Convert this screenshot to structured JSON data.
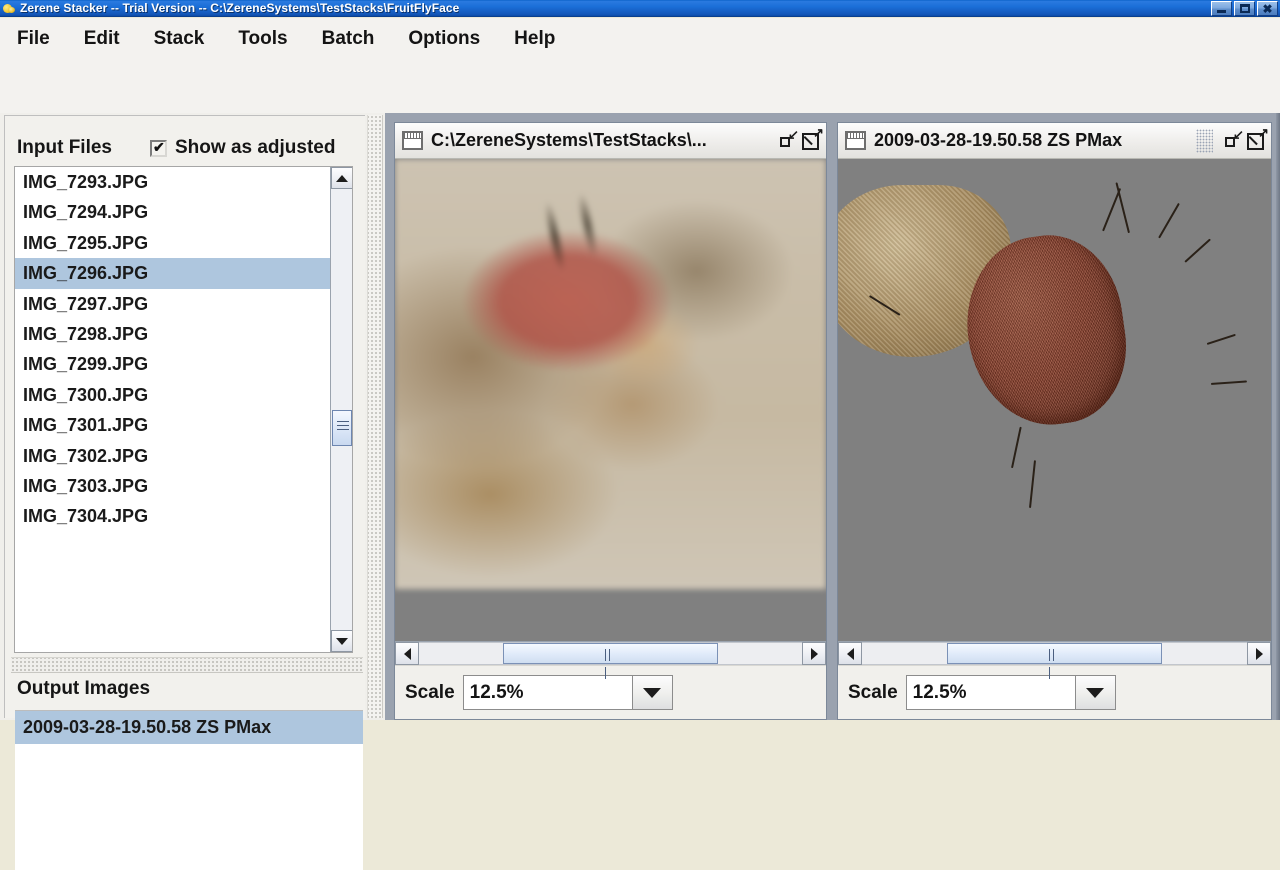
{
  "window": {
    "title": "Zerene Stacker -- Trial Version -- C:\\ZereneSystems\\TestStacks\\FruitFlyFace",
    "icon": "zerene-app-icon",
    "buttons": {
      "minimize": "minimize-icon",
      "maximize": "maximize-icon",
      "close": "close-icon"
    }
  },
  "menubar": {
    "items": [
      {
        "label": "File"
      },
      {
        "label": "Edit"
      },
      {
        "label": "Stack"
      },
      {
        "label": "Tools"
      },
      {
        "label": "Batch"
      },
      {
        "label": "Options"
      },
      {
        "label": "Help"
      }
    ]
  },
  "left_panel": {
    "input_files_label": "Input Files",
    "show_as_adjusted": {
      "label": "Show as adjusted",
      "checked": true
    },
    "files": [
      {
        "name": "IMG_7293.JPG",
        "selected": false
      },
      {
        "name": "IMG_7294.JPG",
        "selected": false
      },
      {
        "name": "IMG_7295.JPG",
        "selected": false
      },
      {
        "name": "IMG_7296.JPG",
        "selected": true
      },
      {
        "name": "IMG_7297.JPG",
        "selected": false
      },
      {
        "name": "IMG_7298.JPG",
        "selected": false
      },
      {
        "name": "IMG_7299.JPG",
        "selected": false
      },
      {
        "name": "IMG_7300.JPG",
        "selected": false
      },
      {
        "name": "IMG_7301.JPG",
        "selected": false
      },
      {
        "name": "IMG_7302.JPG",
        "selected": false
      },
      {
        "name": "IMG_7303.JPG",
        "selected": false
      },
      {
        "name": "IMG_7304.JPG",
        "selected": false
      }
    ],
    "output_images_label": "Output Images",
    "output_images": [
      {
        "name": "2009-03-28-19.50.58 ZS PMax",
        "selected": true
      }
    ]
  },
  "frames": [
    {
      "id": "input-preview",
      "caption": "C:\\ZereneSystems\\TestStacks\\...",
      "icon": "window-frame-icon",
      "restore_icon": "restore-down-icon",
      "maximize_icon": "maximize-window-icon",
      "scale_label": "Scale",
      "scale_value": "12.5%",
      "scale_dropdown_icon": "chevron-down-icon"
    },
    {
      "id": "output-preview",
      "caption": "2009-03-28-19.50.58 ZS PMax",
      "icon": "window-frame-icon",
      "restore_icon": "restore-down-icon",
      "maximize_icon": "maximize-window-icon",
      "scale_label": "Scale",
      "scale_value": "12.5%",
      "scale_dropdown_icon": "chevron-down-icon"
    }
  ],
  "colors": {
    "titlebar_start": "#0a62c8",
    "titlebar_end": "#0c4aa6",
    "selection": "#aec6de",
    "panel_bg": "#f2f1ed",
    "desktop_bg": "#9aa2af",
    "photo_bg": "#808080"
  }
}
